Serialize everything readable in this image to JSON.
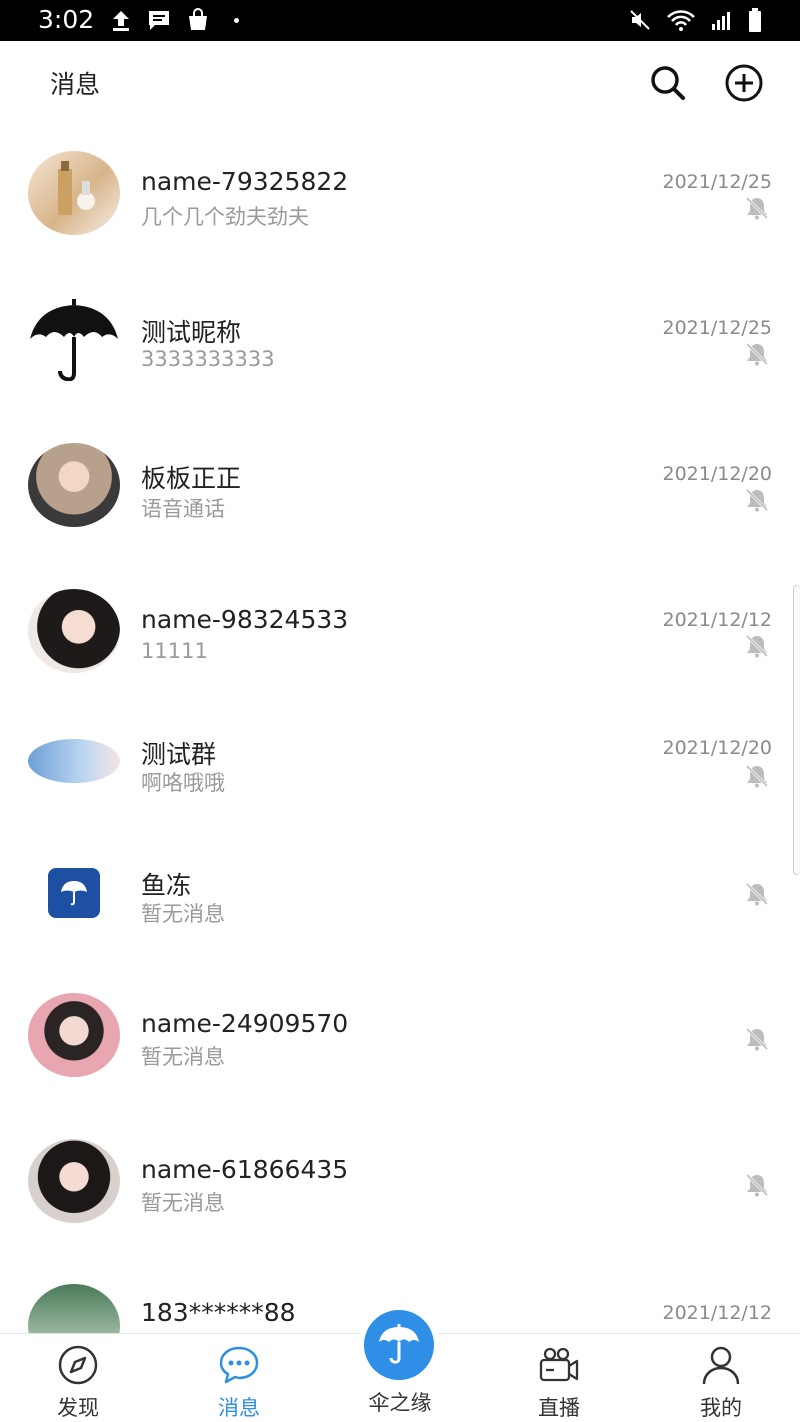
{
  "status_bar": {
    "time": "3:02",
    "left_icons": [
      "upload-icon",
      "chat-bubble-icon",
      "shopping-bag-icon"
    ],
    "right_icons": [
      "mute-icon",
      "wifi-icon",
      "signal-icon",
      "battery-icon"
    ]
  },
  "header": {
    "title": "消息",
    "actions": [
      "search-icon",
      "add-circle-icon"
    ]
  },
  "conversations": [
    {
      "name": "name-79325822",
      "preview": "几个几个劲夫劲夫",
      "date": "2021/12/25",
      "muted": true,
      "avatar": "cosmetics-photo"
    },
    {
      "name": "测试昵称",
      "preview": "3333333333",
      "date": "2021/12/25",
      "muted": true,
      "avatar": "umbrella-logo"
    },
    {
      "name": "板板正正",
      "preview": "语音通话",
      "date": "2021/12/20",
      "muted": true,
      "avatar": "portrait-photo"
    },
    {
      "name": "name-98324533",
      "preview": "11111",
      "date": "2021/12/12",
      "muted": true,
      "avatar": "portrait-photo"
    },
    {
      "name": "测试群",
      "preview": "啊咯哦哦",
      "date": "2021/12/20",
      "muted": true,
      "avatar": "banner-photo"
    },
    {
      "name": "鱼冻",
      "preview": "暂无消息",
      "date": "",
      "muted": true,
      "avatar": "app-logo"
    },
    {
      "name": "name-24909570",
      "preview": "暂无消息",
      "date": "",
      "muted": true,
      "avatar": "portrait-photo"
    },
    {
      "name": "name-61866435",
      "preview": "暂无消息",
      "date": "",
      "muted": true,
      "avatar": "portrait-photo"
    },
    {
      "name": "183******88",
      "preview": "",
      "date": "2021/12/12",
      "muted": true,
      "avatar": "landscape-photo"
    }
  ],
  "tab_bar": {
    "tabs": [
      {
        "label": "发现",
        "icon": "compass-icon",
        "active": false
      },
      {
        "label": "消息",
        "icon": "chat-dots-icon",
        "active": true
      },
      {
        "label": "伞之缘",
        "icon": "umbrella-icon",
        "active": false
      },
      {
        "label": "直播",
        "icon": "video-camera-icon",
        "active": false
      },
      {
        "label": "我的",
        "icon": "person-icon",
        "active": false
      }
    ]
  },
  "colors": {
    "accent": "#2f8fe6",
    "app_logo_bg": "#1d4fa3",
    "muted_text": "#9a9a9a"
  }
}
